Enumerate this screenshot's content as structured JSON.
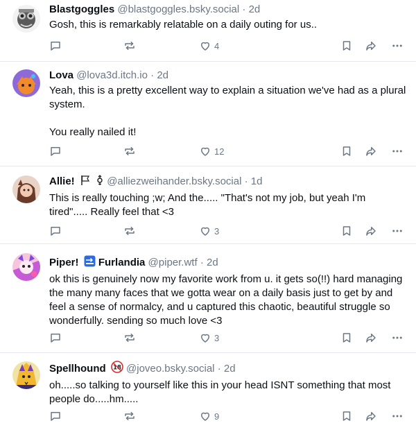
{
  "posts": [
    {
      "name": "Blastgoggles",
      "handle": "@blastgoggles.bsky.social",
      "separator": "·",
      "time": "2d",
      "text": "Gosh, this is remarkably relatable on a daily outing for us..",
      "likes": "4"
    },
    {
      "name": "Lova",
      "handle": "@lova3d.itch.io",
      "separator": "·",
      "time": "2d",
      "text": "Yeah, this is a pretty excellent way to explain a situation we've had as a plural system.\n\nYou really nailed it!",
      "likes": "12"
    },
    {
      "name": "Allie!",
      "name_badges": [
        "🏳️",
        "⚧"
      ],
      "handle": "@alliezweihander.bsky.social",
      "separator": "·",
      "time": "1d",
      "text": "This is really touching ;w; And the..... \"That's not my job, but yeah I'm tired\"..... Really feel that <3",
      "likes": "3"
    },
    {
      "name": "Piper!",
      "name_badges": [
        "🔜"
      ],
      "name_suffix": "Furlandia",
      "handle": "@piper.wtf",
      "separator": "·",
      "time": "2d",
      "text": "ok this is genuinely now my favorite work from u. it gets so(!!) hard managing the many many faces that we gotta wear on a daily basis just to get by and feel a sense of normalcy, and u captured this chaotic, beautiful struggle so wonderfully. sending so much love <3",
      "likes": "3"
    },
    {
      "name": "Spellhound",
      "name_badges": [
        "🔞"
      ],
      "handle": "@joveo.bsky.social",
      "separator": "·",
      "time": "2d",
      "text": "oh.....so talking to yourself like this in your head ISNT something that most people do.....hm.....",
      "likes": "9"
    }
  ],
  "icons": {
    "reply": "reply-icon",
    "repost": "repost-icon",
    "like": "heart-icon",
    "bookmark": "bookmark-icon",
    "share": "share-icon",
    "more": "more-icon"
  },
  "colors": {
    "text": "#0b0f14",
    "muted": "#6b7785",
    "divider": "#e4e8ee"
  }
}
